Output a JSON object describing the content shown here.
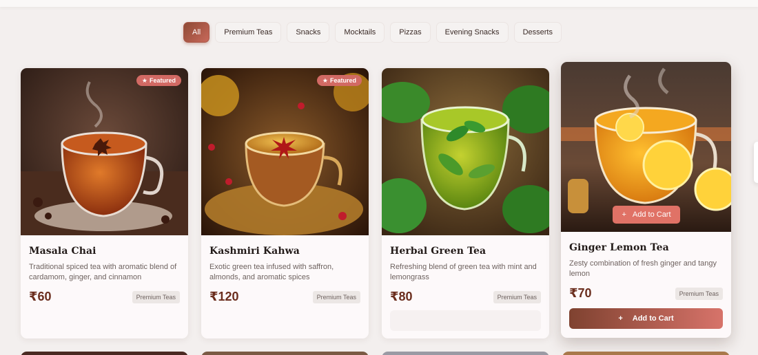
{
  "filters": {
    "items": [
      "All",
      "Premium Teas",
      "Snacks",
      "Mocktails",
      "Pizzas",
      "Evening Snacks",
      "Desserts"
    ],
    "active": "All"
  },
  "badge_label": "Featured",
  "products": [
    {
      "name": "Masala Chai",
      "description": "Traditional spiced tea with aromatic blend of cardamom, ginger, and cinnamon",
      "price": "₹60",
      "category": "Premium Teas",
      "featured": true
    },
    {
      "name": "Kashmiri Kahwa",
      "description": "Exotic green tea infused with saffron, almonds, and aromatic spices",
      "price": "₹120",
      "category": "Premium Teas",
      "featured": true
    },
    {
      "name": "Herbal Green Tea",
      "description": "Refreshing blend of green tea with mint and lemongrass",
      "price": "₹80",
      "category": "Premium Teas",
      "featured": false
    },
    {
      "name": "Ginger Lemon Tea",
      "description": "Zesty combination of fresh ginger and tangy lemon",
      "price": "₹70",
      "category": "Premium Teas",
      "featured": false
    }
  ],
  "add_to_cart_label": "Add to Cart",
  "colors": {
    "accent": "#c8685a",
    "accent_dark": "#7f4230",
    "price": "#6b2e1e",
    "background": "#f3efee"
  }
}
